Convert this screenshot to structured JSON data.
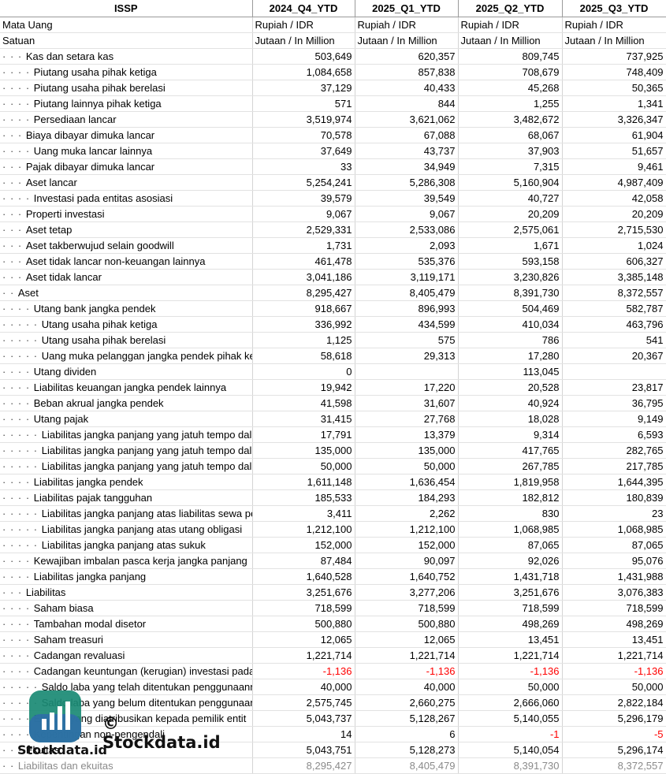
{
  "header": {
    "name": "ISSP",
    "periods": [
      "2024_Q4_YTD",
      "2025_Q1_YTD",
      "2025_Q2_YTD",
      "2025_Q3_YTD"
    ]
  },
  "meta_rows": [
    {
      "label": "Mata Uang",
      "values": [
        "Rupiah / IDR",
        "Rupiah / IDR",
        "Rupiah / IDR",
        "Rupiah / IDR"
      ]
    },
    {
      "label": "Satuan",
      "values": [
        "Jutaan / In Million",
        "Jutaan / In Million",
        "Jutaan / In Million",
        "Jutaan / In Million"
      ]
    }
  ],
  "rows": [
    {
      "indent": "· · · ",
      "label": "Kas dan setara kas",
      "values": [
        "503,649",
        "620,357",
        "809,745",
        "737,925"
      ]
    },
    {
      "indent": "· · · · ",
      "label": "Piutang usaha pihak ketiga",
      "values": [
        "1,084,658",
        "857,838",
        "708,679",
        "748,409"
      ]
    },
    {
      "indent": "· · · · ",
      "label": "Piutang usaha pihak berelasi",
      "values": [
        "37,129",
        "40,433",
        "45,268",
        "50,365"
      ]
    },
    {
      "indent": "· · · · ",
      "label": "Piutang lainnya pihak ketiga",
      "values": [
        "571",
        "844",
        "1,255",
        "1,341"
      ]
    },
    {
      "indent": "· · · · ",
      "label": "Persediaan lancar",
      "values": [
        "3,519,974",
        "3,621,062",
        "3,482,672",
        "3,326,347"
      ]
    },
    {
      "indent": "· · · ",
      "label": "Biaya dibayar dimuka lancar",
      "values": [
        "70,578",
        "67,088",
        "68,067",
        "61,904"
      ]
    },
    {
      "indent": "· · · · ",
      "label": "Uang muka lancar lainnya",
      "values": [
        "37,649",
        "43,737",
        "37,903",
        "51,657"
      ]
    },
    {
      "indent": "· · · ",
      "label": "Pajak dibayar dimuka lancar",
      "values": [
        "33",
        "34,949",
        "7,315",
        "9,461"
      ]
    },
    {
      "indent": "· · · ",
      "label": "Aset lancar",
      "values": [
        "5,254,241",
        "5,286,308",
        "5,160,904",
        "4,987,409"
      ]
    },
    {
      "indent": "· · · · ",
      "label": "Investasi pada entitas asosiasi",
      "values": [
        "39,579",
        "39,549",
        "40,727",
        "42,058"
      ]
    },
    {
      "indent": "· · · ",
      "label": "Properti investasi",
      "values": [
        "9,067",
        "9,067",
        "20,209",
        "20,209"
      ]
    },
    {
      "indent": "· · · ",
      "label": "Aset tetap",
      "values": [
        "2,529,331",
        "2,533,086",
        "2,575,061",
        "2,715,530"
      ]
    },
    {
      "indent": "· · · ",
      "label": "Aset takberwujud selain goodwill",
      "values": [
        "1,731",
        "2,093",
        "1,671",
        "1,024"
      ]
    },
    {
      "indent": "· · · ",
      "label": "Aset tidak lancar non-keuangan lainnya",
      "values": [
        "461,478",
        "535,376",
        "593,158",
        "606,327"
      ]
    },
    {
      "indent": "· · · ",
      "label": "Aset tidak lancar",
      "values": [
        "3,041,186",
        "3,119,171",
        "3,230,826",
        "3,385,148"
      ]
    },
    {
      "indent": "· · ",
      "label": "Aset",
      "values": [
        "8,295,427",
        "8,405,479",
        "8,391,730",
        "8,372,557"
      ]
    },
    {
      "indent": "· · · · ",
      "label": "Utang bank jangka pendek",
      "values": [
        "918,667",
        "896,993",
        "504,469",
        "582,787"
      ]
    },
    {
      "indent": "· · · · · ",
      "label": "Utang usaha pihak ketiga",
      "values": [
        "336,992",
        "434,599",
        "410,034",
        "463,796"
      ]
    },
    {
      "indent": "· · · · · ",
      "label": "Utang usaha pihak berelasi",
      "values": [
        "1,125",
        "575",
        "786",
        "541"
      ]
    },
    {
      "indent": "· · · · · ",
      "label": "Uang muka pelanggan jangka pendek pihak ke",
      "values": [
        "58,618",
        "29,313",
        "17,280",
        "20,367"
      ]
    },
    {
      "indent": "· · · · ",
      "label": "Utang dividen",
      "values": [
        "0",
        "",
        "113,045",
        ""
      ]
    },
    {
      "indent": "· · · · ",
      "label": "Liabilitas keuangan jangka pendek lainnya",
      "values": [
        "19,942",
        "17,220",
        "20,528",
        "23,817"
      ]
    },
    {
      "indent": "· · · · ",
      "label": "Beban akrual jangka pendek",
      "values": [
        "41,598",
        "31,607",
        "40,924",
        "36,795"
      ]
    },
    {
      "indent": "· · · · ",
      "label": "Utang pajak",
      "values": [
        "31,415",
        "27,768",
        "18,028",
        "9,149"
      ]
    },
    {
      "indent": "· · · · · ",
      "label": "Liabilitas jangka panjang yang jatuh tempo dal",
      "values": [
        "17,791",
        "13,379",
        "9,314",
        "6,593"
      ]
    },
    {
      "indent": "· · · · · ",
      "label": "Liabilitas jangka panjang yang jatuh tempo dal",
      "values": [
        "135,000",
        "135,000",
        "417,765",
        "282,765"
      ]
    },
    {
      "indent": "· · · · · ",
      "label": "Liabilitas jangka panjang yang jatuh tempo dal",
      "values": [
        "50,000",
        "50,000",
        "267,785",
        "217,785"
      ]
    },
    {
      "indent": "· · · · ",
      "label": "Liabilitas jangka pendek",
      "values": [
        "1,611,148",
        "1,636,454",
        "1,819,958",
        "1,644,395"
      ]
    },
    {
      "indent": "· · · · ",
      "label": "Liabilitas pajak tangguhan",
      "values": [
        "185,533",
        "184,293",
        "182,812",
        "180,839"
      ]
    },
    {
      "indent": "· · · · · ",
      "label": "Liabilitas jangka panjang atas liabilitas sewa pe",
      "values": [
        "3,411",
        "2,262",
        "830",
        "23"
      ]
    },
    {
      "indent": "· · · · · ",
      "label": "Liabilitas jangka panjang atas utang obligasi",
      "values": [
        "1,212,100",
        "1,212,100",
        "1,068,985",
        "1,068,985"
      ]
    },
    {
      "indent": "· · · · · ",
      "label": "Liabilitas jangka panjang atas sukuk",
      "values": [
        "152,000",
        "152,000",
        "87,065",
        "87,065"
      ]
    },
    {
      "indent": "· · · · ",
      "label": "Kewajiban imbalan pasca kerja jangka panjang",
      "values": [
        "87,484",
        "90,097",
        "92,026",
        "95,076"
      ]
    },
    {
      "indent": "· · · · ",
      "label": "Liabilitas jangka panjang",
      "values": [
        "1,640,528",
        "1,640,752",
        "1,431,718",
        "1,431,988"
      ]
    },
    {
      "indent": "· · · ",
      "label": "Liabilitas",
      "values": [
        "3,251,676",
        "3,277,206",
        "3,251,676",
        "3,076,383"
      ]
    },
    {
      "indent": "· · · · ",
      "label": "Saham biasa",
      "values": [
        "718,599",
        "718,599",
        "718,599",
        "718,599"
      ]
    },
    {
      "indent": "· · · · ",
      "label": "Tambahan modal disetor",
      "values": [
        "500,880",
        "500,880",
        "498,269",
        "498,269"
      ]
    },
    {
      "indent": "· · · · ",
      "label": "Saham treasuri",
      "values": [
        "12,065",
        "12,065",
        "13,451",
        "13,451"
      ]
    },
    {
      "indent": "· · · · ",
      "label": "Cadangan revaluasi",
      "values": [
        "1,221,714",
        "1,221,714",
        "1,221,714",
        "1,221,714"
      ]
    },
    {
      "indent": "· · · · ",
      "label": "Cadangan keuntungan (kerugian) investasi pada",
      "values": [
        "-1,136",
        "-1,136",
        "-1,136",
        "-1,136"
      ],
      "negative": true
    },
    {
      "indent": "· · · · · ",
      "label": "Saldo laba yang telah ditentukan penggunaann",
      "values": [
        "40,000",
        "40,000",
        "50,000",
        "50,000"
      ]
    },
    {
      "indent": "· · · · · ",
      "label": "Saldo laba yang belum ditentukan penggunaan",
      "values": [
        "2,575,745",
        "2,660,275",
        "2,666,060",
        "2,822,184"
      ]
    },
    {
      "indent": "· · · · ",
      "label": "Ekuitas yang diatribusikan kepada pemilik entit",
      "values": [
        "5,043,737",
        "5,128,267",
        "5,140,055",
        "5,296,179"
      ]
    },
    {
      "indent": "· · · · ",
      "label": "Kepentingan non-pengendali",
      "values": [
        "14",
        "6",
        "-1",
        "-5"
      ],
      "negative_cols": [
        2,
        3
      ]
    },
    {
      "indent": "· · · ",
      "label": "Ekuitas",
      "values": [
        "5,043,751",
        "5,128,273",
        "5,140,054",
        "5,296,174"
      ]
    },
    {
      "indent": "· · ",
      "label": "Liabilitas dan ekuitas",
      "values": [
        "8,295,427",
        "8,405,479",
        "8,391,730",
        "8,372,557"
      ],
      "faded": true
    }
  ],
  "watermark": {
    "text": "© Stockdata.id",
    "brand": "Stockdata.id",
    "logo_colors": [
      "#1a8a74",
      "#2f6fa8"
    ]
  }
}
